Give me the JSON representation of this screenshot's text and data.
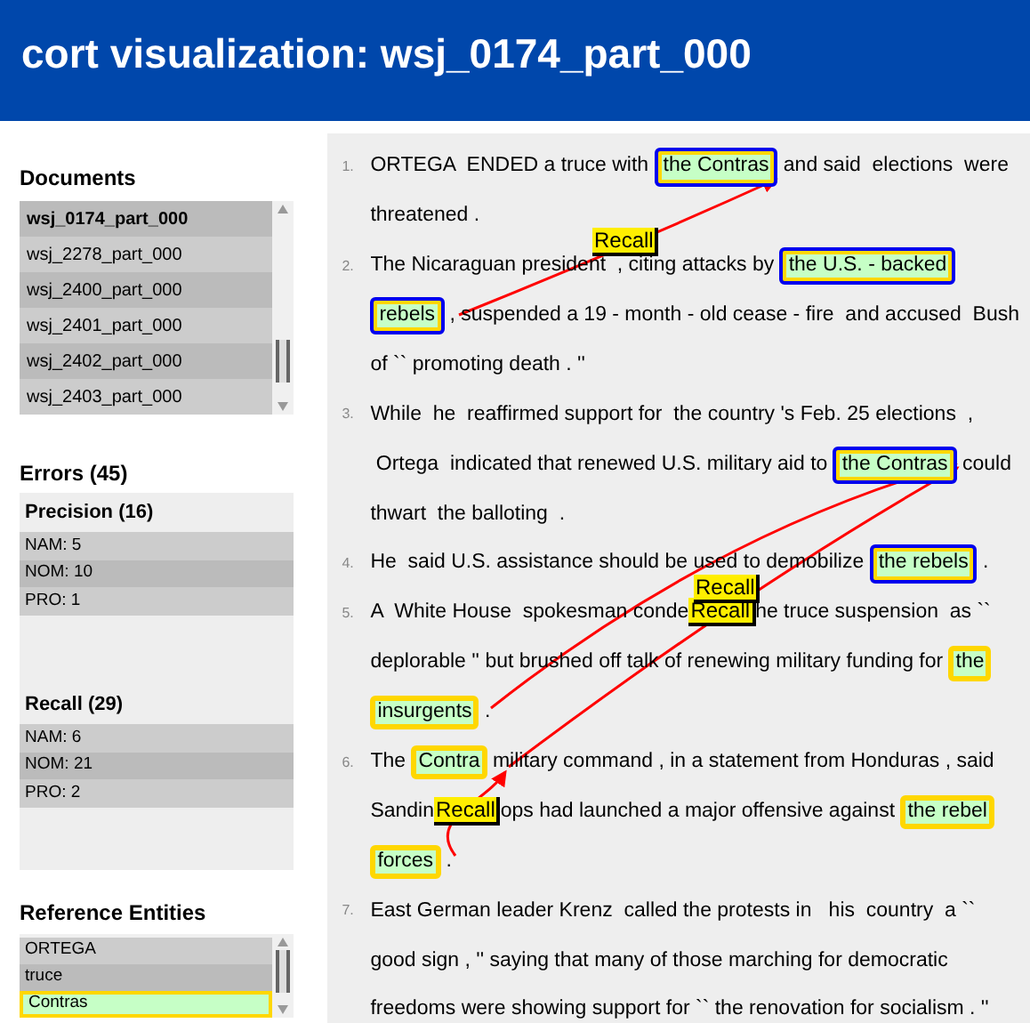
{
  "header": {
    "title": "cort visualization: wsj_0174_part_000"
  },
  "documents": {
    "title": "Documents",
    "items": [
      {
        "label": "wsj_0174_part_000",
        "selected": true
      },
      {
        "label": "wsj_2278_part_000",
        "selected": false
      },
      {
        "label": "wsj_2400_part_000",
        "selected": false
      },
      {
        "label": "wsj_2401_part_000",
        "selected": false
      },
      {
        "label": "wsj_2402_part_000",
        "selected": false
      },
      {
        "label": "wsj_2403_part_000",
        "selected": false
      }
    ]
  },
  "errors": {
    "title": "Errors (45)",
    "groups": [
      {
        "title": "Precision (16)",
        "items": [
          "NAM: 5",
          "NOM: 10",
          "PRO: 1"
        ]
      },
      {
        "title": "Recall (29)",
        "items": [
          "NAM: 6",
          "NOM: 21",
          "PRO: 2"
        ]
      }
    ]
  },
  "reference_entities": {
    "title": "Reference Entities",
    "items": [
      {
        "label": "ORTEGA",
        "selected": false
      },
      {
        "label": "truce",
        "selected": false
      },
      {
        "label": "Contras",
        "selected": true
      }
    ]
  },
  "document_text": {
    "floating_labels": [
      {
        "text": "Recall"
      },
      {
        "text": "Recall"
      }
    ],
    "sentences": [
      {
        "number": "1.",
        "lines": [
          [
            {
              "kind": "text",
              "text": "ORTEGA  ENDED a truce with "
            },
            {
              "kind": "mention",
              "linked": true,
              "text": "the Contras"
            },
            {
              "kind": "text",
              "text": " and said  elections  were"
            }
          ],
          [
            {
              "kind": "text",
              "text": "threatened ."
            }
          ]
        ]
      },
      {
        "number": "2.",
        "lines": [
          [
            {
              "kind": "text",
              "text": "The Nicaraguan president  , citing attacks by "
            },
            {
              "kind": "mention",
              "linked": true,
              "text": "the U.S. - backed"
            }
          ],
          [
            {
              "kind": "mention",
              "linked": true,
              "text": "rebels"
            },
            {
              "kind": "text",
              "text": " , suspended a 19 - month - old cease - fire  and accused  Bush"
            }
          ],
          [
            {
              "kind": "text",
              "text": "of `` promoting death . ''"
            }
          ]
        ]
      },
      {
        "number": "3.",
        "lines": [
          [
            {
              "kind": "text",
              "text": "While  he  reaffirmed support for  the country 's Feb. 25 elections  ,"
            }
          ],
          [
            {
              "kind": "text",
              "text": " Ortega  indicated that renewed U.S. military aid to "
            },
            {
              "kind": "mention",
              "linked": true,
              "text": "the Contras"
            },
            {
              "kind": "text",
              "text": " could"
            }
          ],
          [
            {
              "kind": "text",
              "text": "thwart  the balloting  ."
            }
          ]
        ]
      },
      {
        "number": "4.",
        "lines": [
          [
            {
              "kind": "text",
              "text": "He  said U.S. assistance should be used to demobilize "
            },
            {
              "kind": "mention",
              "linked": true,
              "text": "the rebels"
            },
            {
              "kind": "text",
              "text": " ."
            }
          ]
        ]
      },
      {
        "number": "5.",
        "lines": [
          [
            {
              "kind": "text",
              "text": "A  White House  spokesman conde"
            },
            {
              "kind": "label",
              "text": "Recall"
            },
            {
              "kind": "text",
              "text": "he truce suspension  as ``"
            }
          ],
          [
            {
              "kind": "text",
              "text": "deplorable '' but brushed off talk of renewing military funding for "
            },
            {
              "kind": "mention",
              "linked": false,
              "text": "the"
            }
          ],
          [
            {
              "kind": "mention",
              "linked": false,
              "text": "insurgents"
            },
            {
              "kind": "text",
              "text": " ."
            }
          ]
        ]
      },
      {
        "number": "6.",
        "lines": [
          [
            {
              "kind": "text",
              "text": "The "
            },
            {
              "kind": "mention",
              "linked": false,
              "text": "Contra"
            },
            {
              "kind": "text",
              "text": " military command , in a statement from Honduras , said"
            }
          ],
          [
            {
              "kind": "text",
              "text": "Sandin"
            },
            {
              "kind": "label",
              "text": "Recall"
            },
            {
              "kind": "text",
              "text": "ops had launched a major offensive against "
            },
            {
              "kind": "mention",
              "linked": false,
              "text": "the rebel"
            }
          ],
          [
            {
              "kind": "mention",
              "linked": false,
              "text": "forces"
            },
            {
              "kind": "text",
              "text": " ."
            }
          ]
        ]
      },
      {
        "number": "7.",
        "lines": [
          [
            {
              "kind": "text",
              "text": "East German leader Krenz  called the protests in   his  country  a ``"
            }
          ],
          [
            {
              "kind": "text",
              "text": "good sign , '' saying that many of those marching for democratic"
            }
          ],
          [
            {
              "kind": "text",
              "text": "freedoms were showing support for `` the renovation for socialism . ''"
            }
          ]
        ]
      }
    ]
  }
}
